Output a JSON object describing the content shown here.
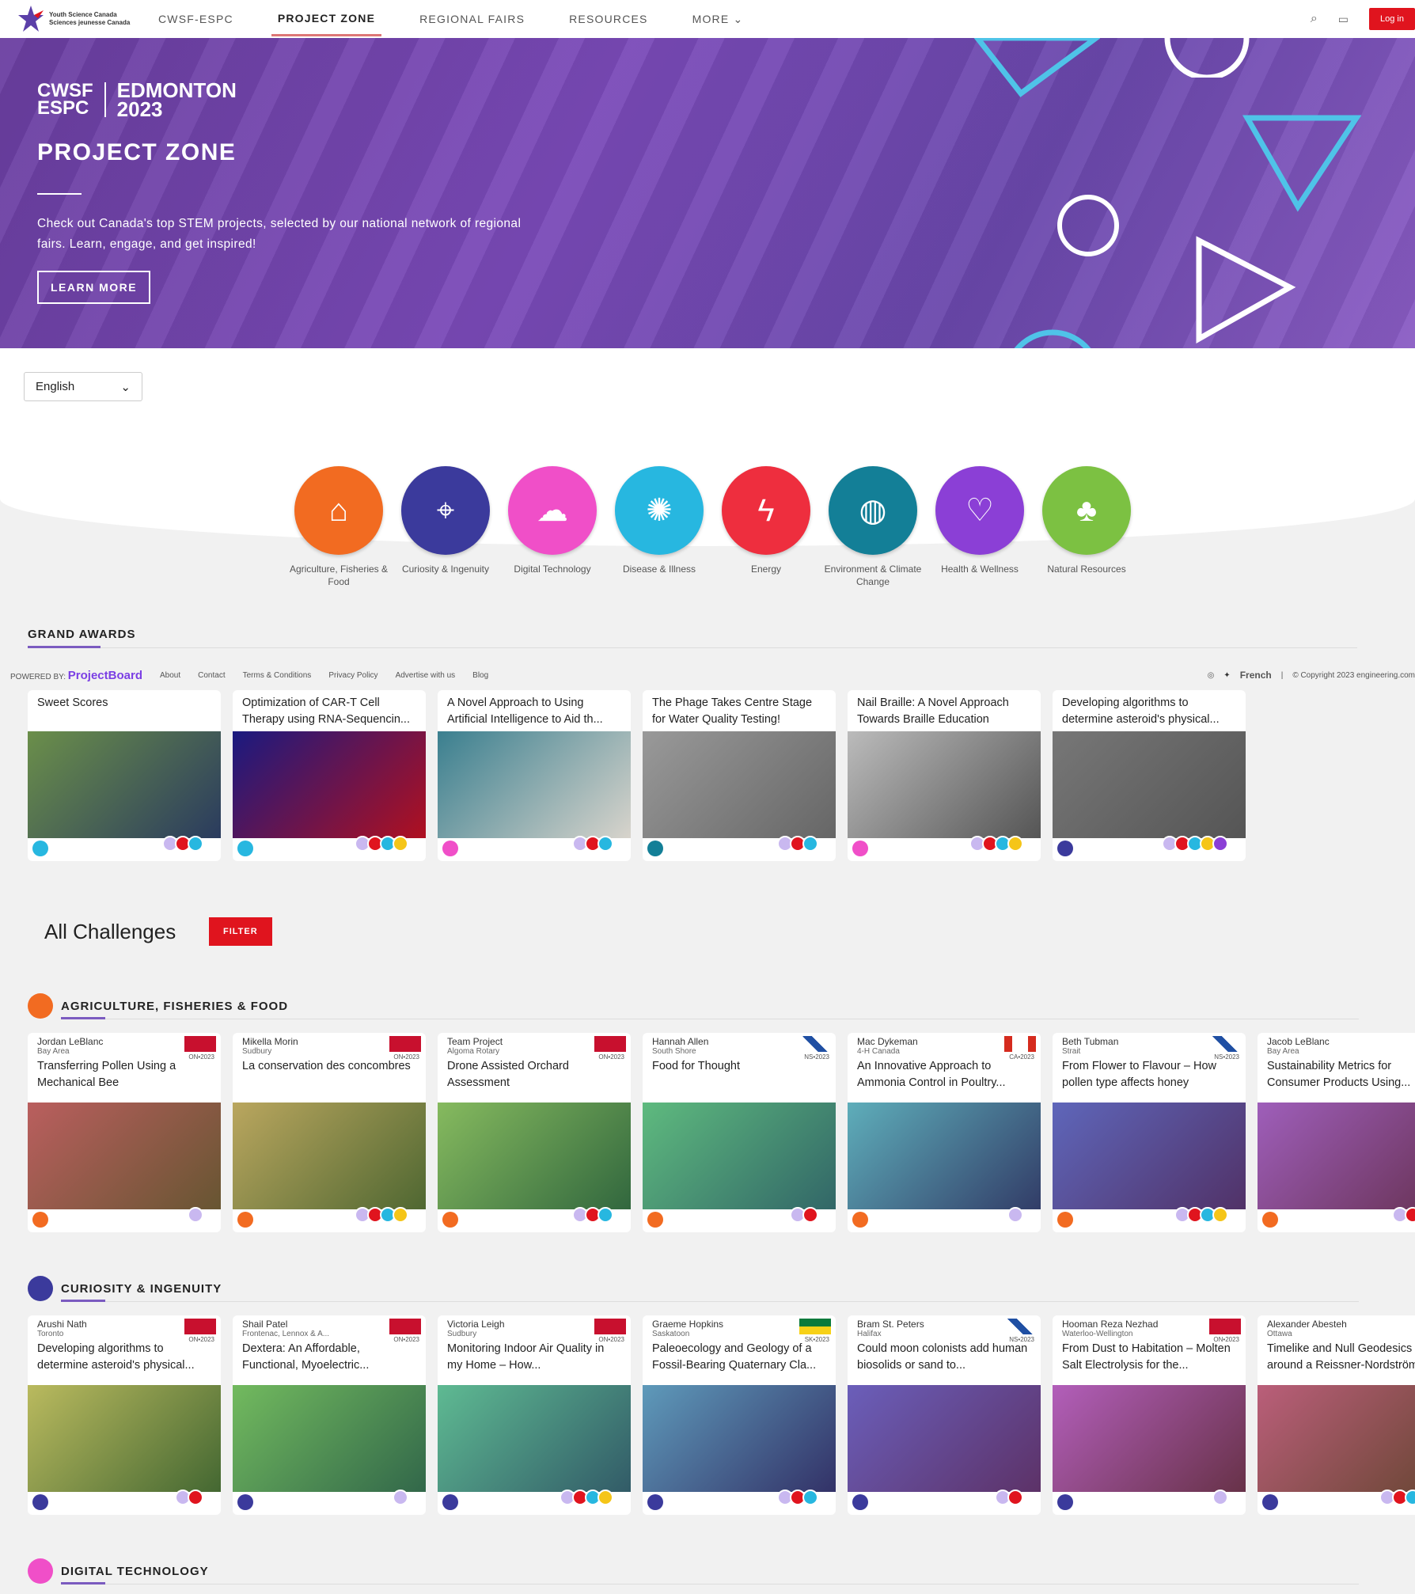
{
  "nav": {
    "logo_line1": "Youth Science Canada",
    "logo_line2": "Sciences jeunesse Canada",
    "items": [
      "CWSF-ESPC",
      "PROJECT ZONE",
      "REGIONAL FAIRS",
      "RESOURCES",
      "MORE"
    ],
    "active": 1,
    "login": "Log in"
  },
  "hero": {
    "logo_a1": "CWSF",
    "logo_a2": "ESPC",
    "logo_b1": "EDMONTON",
    "logo_b2": "2023",
    "title": "PROJECT ZONE",
    "text": "Check out Canada's top STEM projects, selected by our national network of regional fairs. Learn, engage, and get inspired!",
    "button": "LEARN MORE"
  },
  "language": {
    "selected": "English"
  },
  "categories": [
    {
      "label": "Agriculture, Fisheries & Food",
      "color": "#f26b21",
      "icon": "farm-icon"
    },
    {
      "label": "Curiosity & Ingenuity",
      "color": "#3b3a9c",
      "icon": "telescope-icon"
    },
    {
      "label": "Digital Technology",
      "color": "#f04fc8",
      "icon": "cloud-circuit-icon"
    },
    {
      "label": "Disease & Illness",
      "color": "#27b7e0",
      "icon": "virus-icon"
    },
    {
      "label": "Energy",
      "color": "#ee2e3e",
      "icon": "energy-icon"
    },
    {
      "label": "Environment & Climate Change",
      "color": "#137f97",
      "icon": "globe-icon"
    },
    {
      "label": "Health & Wellness",
      "color": "#8b3fd6",
      "icon": "person-heart-icon"
    },
    {
      "label": "Natural Resources",
      "color": "#7cc142",
      "icon": "earth-tree-icon"
    }
  ],
  "grand_awards": {
    "title": "GRAND AWARDS",
    "items": [
      {
        "title": "Sweet Scores",
        "cat": 3
      },
      {
        "title": "Optimization of CAR-T Cell Therapy using RNA-Sequencin...",
        "cat": 3
      },
      {
        "title": "A Novel Approach to Using Artificial Intelligence to Aid th...",
        "cat": 2
      },
      {
        "title": "The Phage Takes Centre Stage for Water Quality Testing!",
        "cat": 5
      },
      {
        "title": "Nail Braille: A Novel Approach Towards Braille Education",
        "cat": 2
      },
      {
        "title": "Developing algorithms to determine asteroid's physical...",
        "cat": 1
      }
    ]
  },
  "footer": {
    "powered": "POWERED BY:",
    "brand": "ProjectBoard",
    "links": [
      "About",
      "Contact",
      "Terms & Conditions",
      "Privacy Policy",
      "Advertise with us",
      "Blog"
    ],
    "lang": "French",
    "copyright": "© Copyright 2023 engineering.com"
  },
  "challenges": {
    "title": "All Challenges",
    "filter": "FILTER"
  },
  "sections": [
    {
      "title": "AGRICULTURE, FISHERIES & FOOD",
      "cat": 0,
      "items": [
        {
          "author": "Jordan LeBlanc",
          "region": "Bay Area",
          "code": "ON•2023",
          "flag": "on",
          "title": "Transferring Pollen Using a Mechanical Bee"
        },
        {
          "author": "Mikella Morin",
          "region": "Sudbury",
          "code": "ON•2023",
          "flag": "on",
          "title": "La conservation des concombres"
        },
        {
          "author": "Team Project",
          "region": "Algoma Rotary",
          "code": "ON•2023",
          "flag": "on",
          "title": "Drone Assisted Orchard Assessment"
        },
        {
          "author": "Hannah Allen",
          "region": "South Shore",
          "code": "NS•2023",
          "flag": "ns",
          "title": "Food for Thought"
        },
        {
          "author": "Mac Dykeman",
          "region": "4-H Canada",
          "code": "CA•2023",
          "flag": "ca",
          "title": "An Innovative Approach to Ammonia Control in Poultry..."
        },
        {
          "author": "Beth Tubman",
          "region": "Strait",
          "code": "NS•2023",
          "flag": "ns",
          "title": "From Flower to Flavour – How pollen type affects honey"
        },
        {
          "author": "Jacob LeBlanc",
          "region": "Bay Area",
          "code": "",
          "flag": "",
          "title": "Sustainability Metrics for Consumer Products Using..."
        }
      ]
    },
    {
      "title": "CURIOSITY & INGENUITY",
      "cat": 1,
      "items": [
        {
          "author": "Arushi Nath",
          "region": "Toronto",
          "code": "ON•2023",
          "flag": "on",
          "title": "Developing algorithms to determine asteroid's physical..."
        },
        {
          "author": "Shail Patel",
          "region": "Frontenac, Lennox & A...",
          "code": "ON•2023",
          "flag": "on",
          "title": "Dextera: An Affordable, Functional, Myoelectric..."
        },
        {
          "author": "Victoria Leigh",
          "region": "Sudbury",
          "code": "ON•2023",
          "flag": "on",
          "title": "Monitoring Indoor Air Quality in my Home – How..."
        },
        {
          "author": "Graeme Hopkins",
          "region": "Saskatoon",
          "code": "SK•2023",
          "flag": "sk",
          "title": "Paleoecology and Geology of a Fossil-Bearing Quaternary Cla..."
        },
        {
          "author": "Bram St. Peters",
          "region": "Halifax",
          "code": "NS•2023",
          "flag": "ns",
          "title": "Could moon colonists add human biosolids or sand to..."
        },
        {
          "author": "Hooman Reza Nezhad",
          "region": "Waterloo-Wellington",
          "code": "ON•2023",
          "flag": "on",
          "title": "From Dust to Habitation – Molten Salt Electrolysis for the..."
        },
        {
          "author": "Alexander Abesteh",
          "region": "Ottawa",
          "code": "",
          "flag": "",
          "title": "Timelike and Null Geodesics around a Reissner-Nordström..."
        }
      ]
    },
    {
      "title": "DIGITAL TECHNOLOGY",
      "cat": 2,
      "items": []
    }
  ]
}
